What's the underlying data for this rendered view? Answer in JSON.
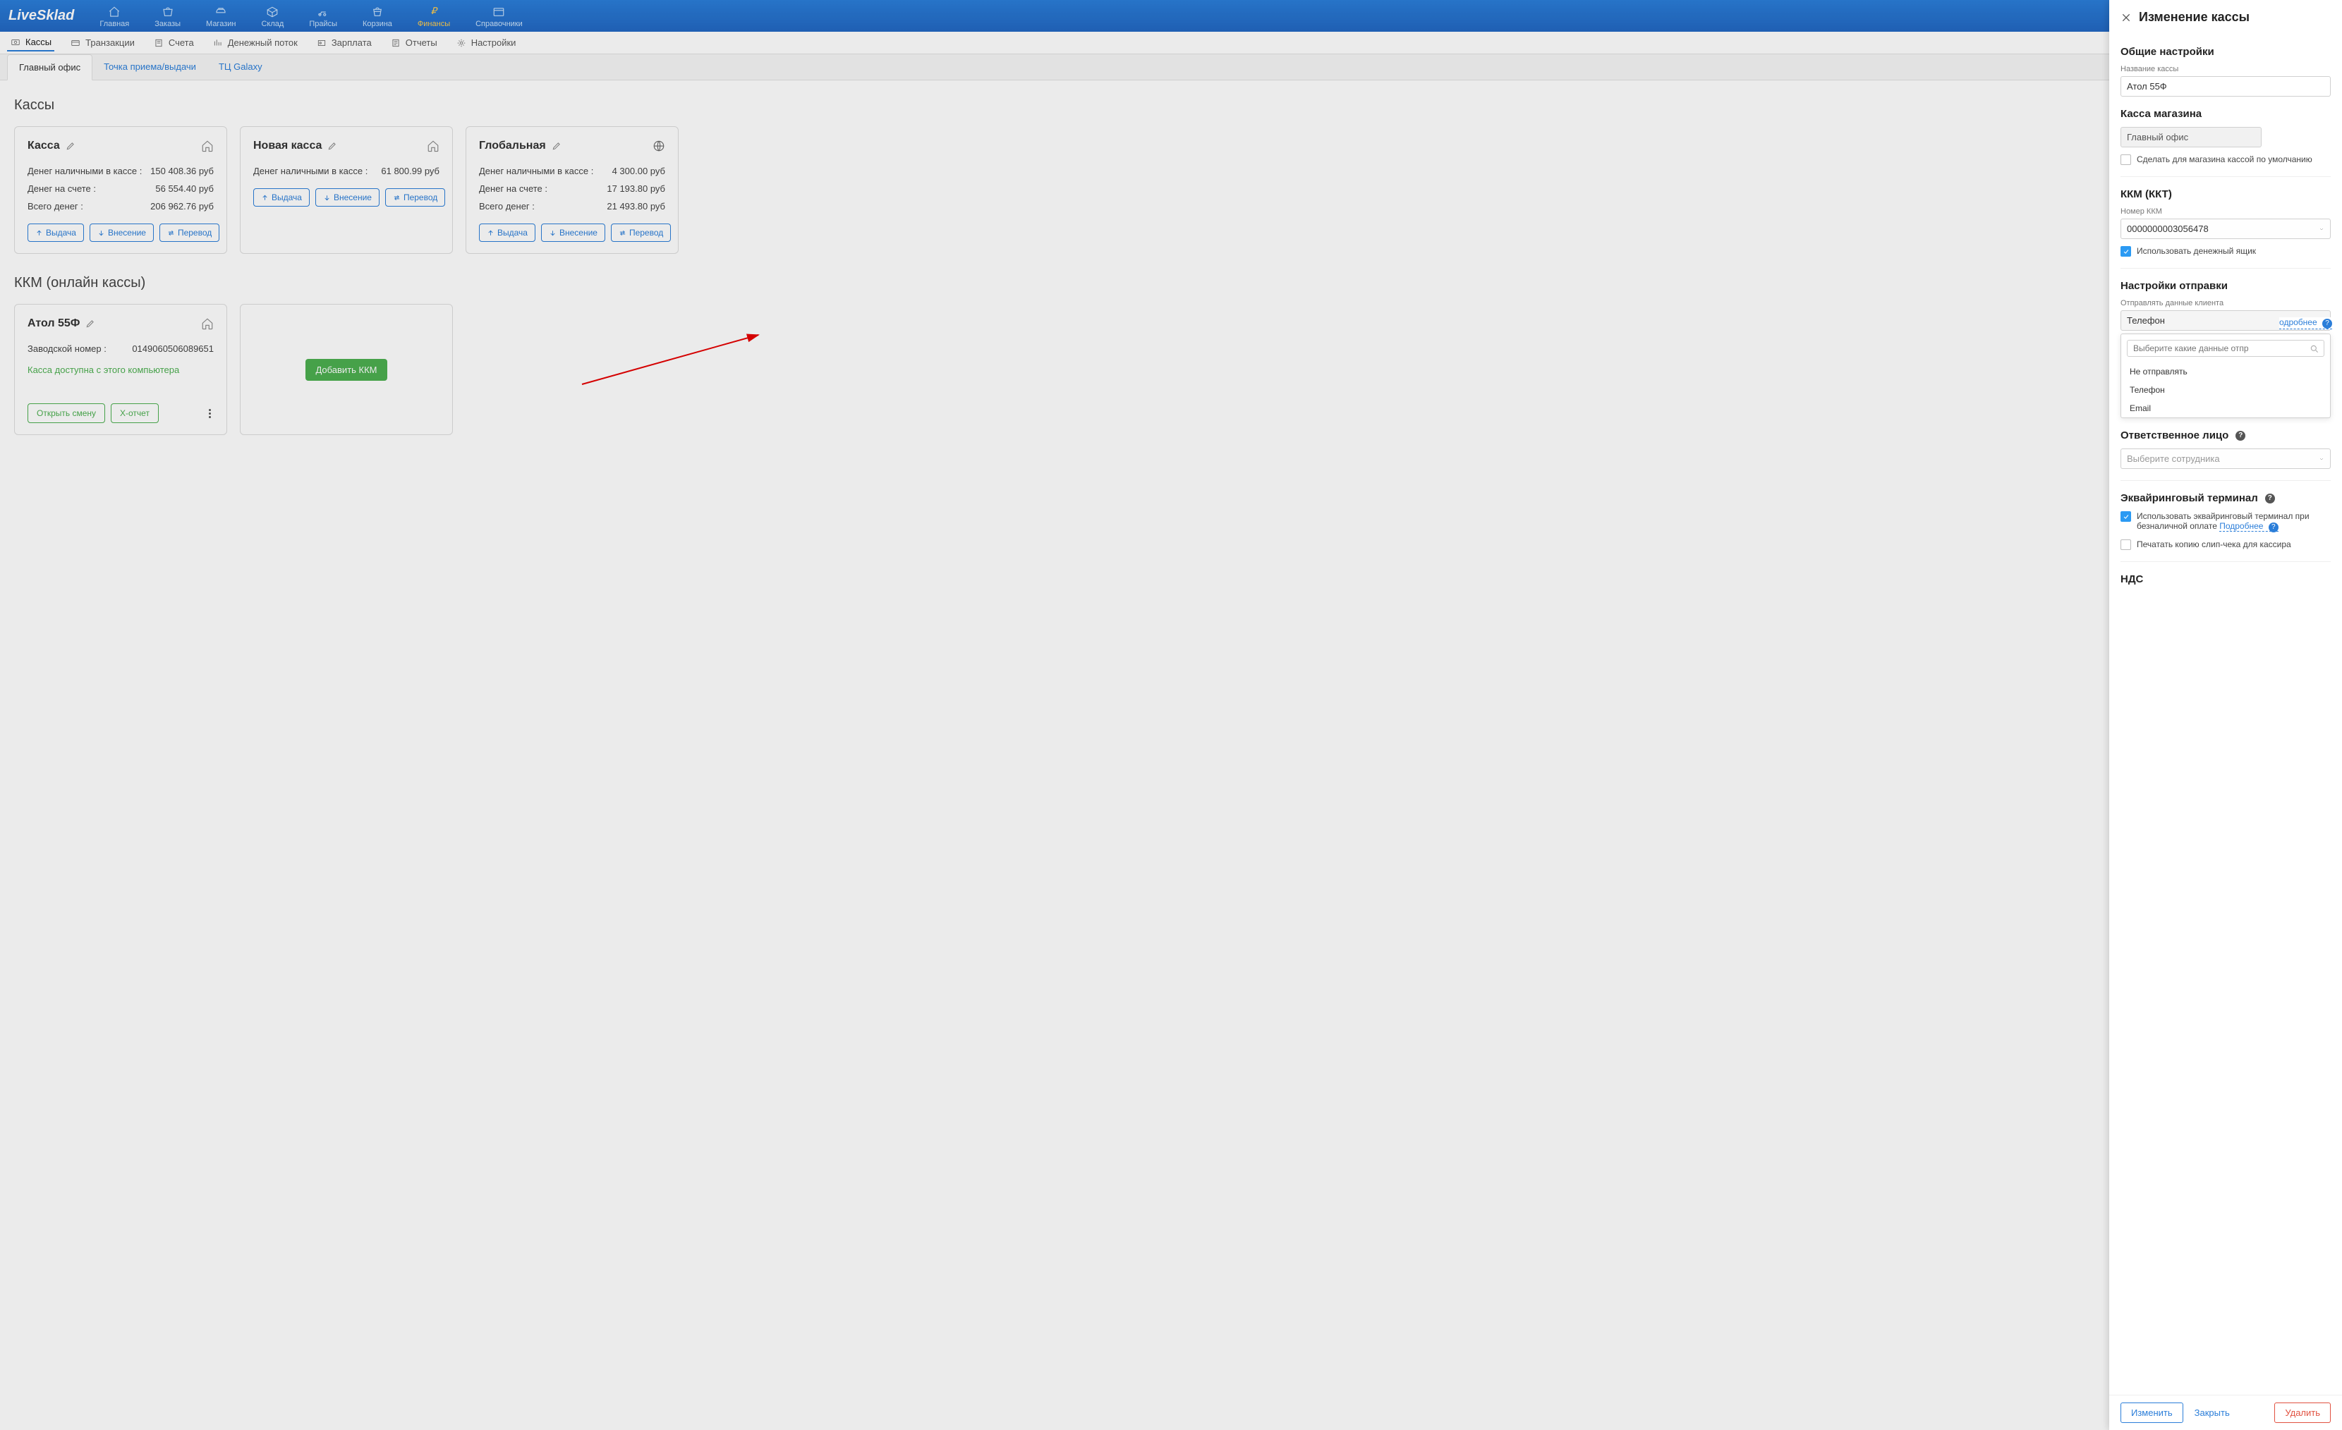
{
  "logo": "LiveSklad",
  "top_nav": [
    {
      "label": "Главная"
    },
    {
      "label": "Заказы"
    },
    {
      "label": "Магазин"
    },
    {
      "label": "Склад"
    },
    {
      "label": "Прайсы"
    },
    {
      "label": "Корзина"
    },
    {
      "label": "Финансы",
      "active": true
    },
    {
      "label": "Справочники"
    }
  ],
  "sub_nav": [
    {
      "label": "Кассы",
      "active": true
    },
    {
      "label": "Транзакции"
    },
    {
      "label": "Счета"
    },
    {
      "label": "Денежный поток"
    },
    {
      "label": "Зарплата"
    },
    {
      "label": "Отчеты"
    },
    {
      "label": "Настройки"
    }
  ],
  "tabs": [
    {
      "label": "Главный офис",
      "active": true
    },
    {
      "label": "Точка приема/выдачи"
    },
    {
      "label": "ТЦ Galaxy"
    }
  ],
  "sections": {
    "kassy_title": "Кассы",
    "kkm_title": "ККМ (онлайн кассы)"
  },
  "kassy_cards": [
    {
      "title": "Касса",
      "icon": "home",
      "rows": [
        {
          "label": "Денег наличными в кассе :",
          "value": "150 408.36 руб"
        },
        {
          "label": "Денег на счете :",
          "value": "56 554.40 руб"
        },
        {
          "label": "Всего денег :",
          "value": "206 962.76 руб"
        }
      ]
    },
    {
      "title": "Новая касса",
      "icon": "home",
      "rows": [
        {
          "label": "Денег наличными в кассе :",
          "value": "61 800.99 руб"
        }
      ]
    },
    {
      "title": "Глобальная",
      "icon": "globe",
      "rows": [
        {
          "label": "Денег наличными в кассе :",
          "value": "4 300.00 руб"
        },
        {
          "label": "Денег на счете :",
          "value": "17 193.80 руб"
        },
        {
          "label": "Всего денег :",
          "value": "21 493.80 руб"
        }
      ]
    }
  ],
  "card_actions": {
    "withdraw": "Выдача",
    "deposit": "Внесение",
    "transfer": "Перевод"
  },
  "kkm_card": {
    "title": "Атол 55Ф",
    "serial_label": "Заводской номер :",
    "serial_value": "0149060506089651",
    "status": "Касса доступна с этого компьютера",
    "open_shift": "Открыть смену",
    "x_report": "X-отчет"
  },
  "add_kkm_label": "Добавить ККМ",
  "panel": {
    "title": "Изменение кассы",
    "general_title": "Общие настройки",
    "name_label": "Название кассы",
    "name_value": "Атол 55Ф",
    "store_title": "Касса магазина",
    "store_value": "Главный офис",
    "default_checkbox": "Сделать для магазина кассой по умолчанию",
    "kkm_title": "ККМ (ККТ)",
    "kkm_number_label": "Номер ККМ",
    "kkm_number_value": "0000000003056478",
    "use_drawer": "Использовать денежный ящик",
    "send_title": "Настройки отправки",
    "send_label": "Отправлять данные клиента",
    "send_value": "Телефон",
    "dropdown_search_placeholder": "Выберите какие данные отпр",
    "dropdown_options": [
      "Не отправлять",
      "Телефон",
      "Email"
    ],
    "more_link": "одробнее",
    "resp_title": "Ответственное лицо",
    "resp_placeholder": "Выберите сотрудника",
    "acq_title": "Эквайринговый терминал",
    "acq_checkbox": "Использовать эквайринговый терминал при безналичной оплате",
    "acq_more": "Подробнее",
    "slip_checkbox": "Печатать копию слип-чека для кассира",
    "vat_title": "НДС",
    "btn_change": "Изменить",
    "btn_close": "Закрыть",
    "btn_delete": "Удалить"
  }
}
